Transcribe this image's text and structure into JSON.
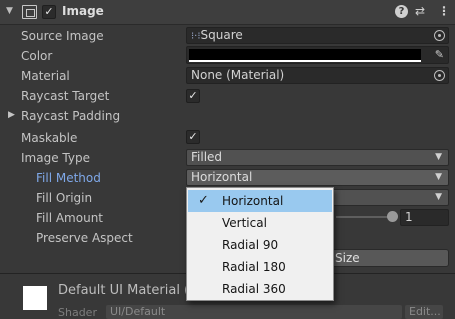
{
  "header": {
    "title": "Image",
    "enabled": true,
    "icons": [
      "foldout-arrow-icon",
      "image-component-icon",
      "help-icon",
      "presets-icon",
      "more-icon"
    ]
  },
  "properties": {
    "source_image": {
      "label": "Source Image",
      "value": "Square"
    },
    "color": {
      "label": "Color",
      "value": "#000000"
    },
    "material": {
      "label": "Material",
      "value": "None (Material)"
    },
    "raycast_target": {
      "label": "Raycast Target",
      "checked": true
    },
    "raycast_padding": {
      "label": "Raycast Padding"
    },
    "maskable": {
      "label": "Maskable",
      "checked": true
    },
    "image_type": {
      "label": "Image Type",
      "value": "Filled"
    },
    "fill_method": {
      "label": "Fill Method",
      "value": "Horizontal"
    },
    "fill_origin": {
      "label": "Fill Origin"
    },
    "fill_amount": {
      "label": "Fill Amount",
      "value": "1"
    },
    "preserve_aspect": {
      "label": "Preserve Aspect"
    },
    "set_native_size": {
      "label": "Size"
    }
  },
  "popup": {
    "options": [
      "Horizontal",
      "Vertical",
      "Radial 90",
      "Radial 180",
      "Radial 360"
    ],
    "selected": "Horizontal"
  },
  "material_section": {
    "title": "Default UI Material (M",
    "shader_label": "Shader",
    "shader_value": "UI/Default",
    "edit_label": "Edit..."
  },
  "colors": {
    "panel_bg": "#383838",
    "popup_bg": "#f0f0f0",
    "popup_selected": "#99c9ef",
    "label_highlight": "#7fa8e8"
  }
}
